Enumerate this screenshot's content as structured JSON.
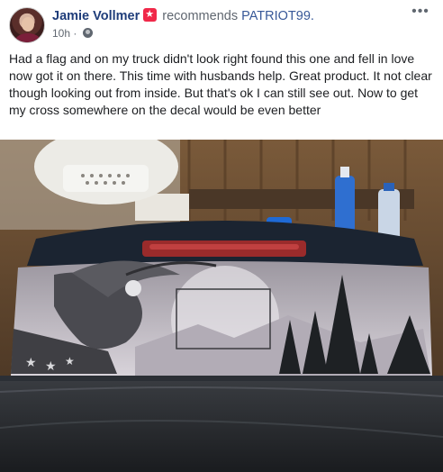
{
  "post": {
    "author": "Jamie Vollmer",
    "verb": "recommends",
    "page": "PATRIOT99.",
    "time": "10h",
    "separator": "·",
    "more": "•••",
    "text": "Had a flag and on my truck didn't look right found this one and fell in love now got it on there. This time with husbands help. Great product. It not clear though looking out from inside. But that's ok I can still see out. Now to get my cross somewhere on the decal would be even better"
  },
  "icons": {
    "avatar": "avatar",
    "badge": "recommendation-badge-icon",
    "privacy": "globe-icon",
    "more": "more-options-icon"
  },
  "colors": {
    "author": "#1f3d7a",
    "link": "#385898",
    "meta": "#606770",
    "badge": "#f02849"
  }
}
